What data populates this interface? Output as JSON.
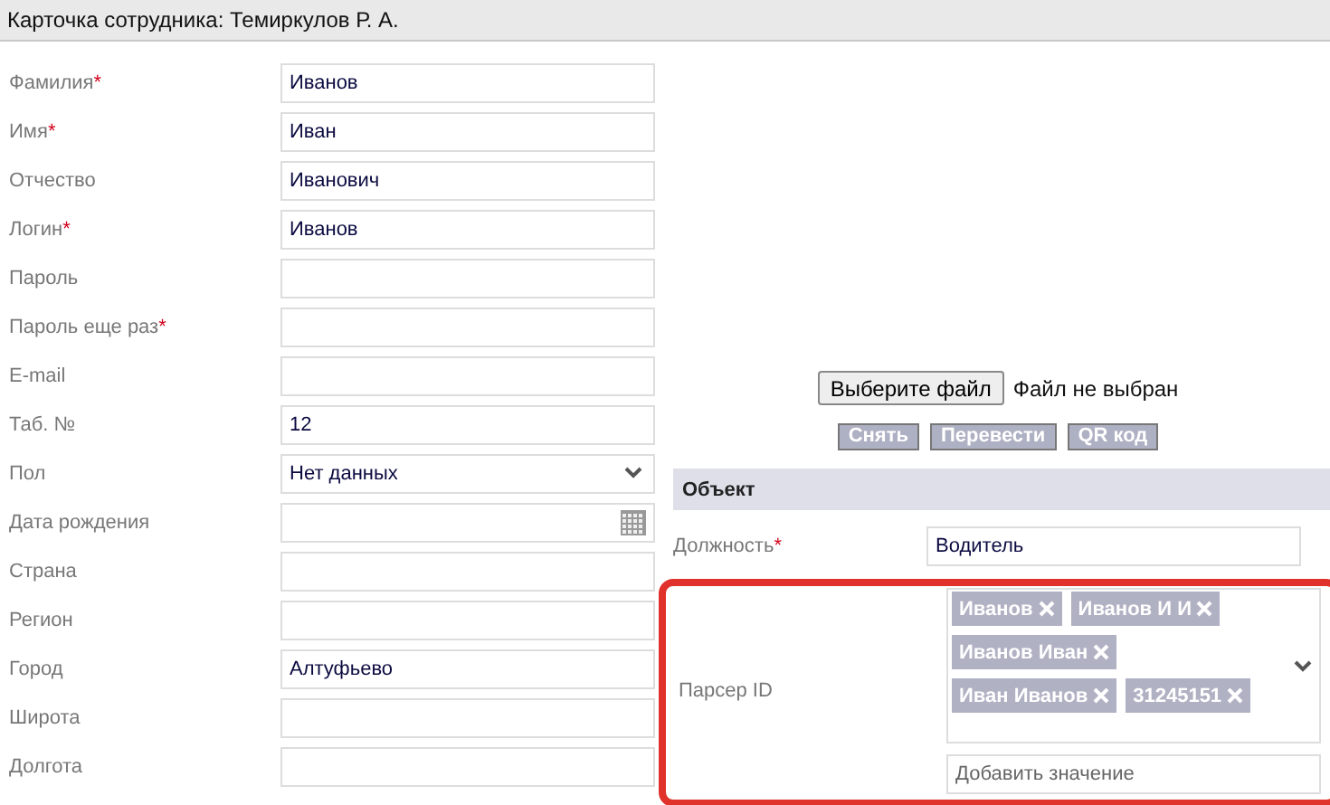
{
  "header": {
    "title": "Карточка сотрудника: Темиркулов Р. А."
  },
  "fields": [
    {
      "label": "Фамилия",
      "required_mark": "*",
      "kind": "text",
      "value": "Иванов"
    },
    {
      "label": "Имя",
      "required_mark": "*",
      "kind": "text",
      "value": "Иван"
    },
    {
      "label": "Отчество",
      "kind": "text",
      "value": "Иванович"
    },
    {
      "label": "Логин",
      "required_mark": "*",
      "kind": "text",
      "value": "Иванов"
    },
    {
      "label": "Пароль",
      "kind": "text"
    },
    {
      "label": "Пароль еще раз",
      "required_mark": "*",
      "kind": "text"
    },
    {
      "label": "E-mail",
      "kind": "text"
    },
    {
      "label": "Таб. №",
      "kind": "text",
      "value": "12"
    },
    {
      "label": "Пол",
      "kind": "select",
      "value": "Нет данных"
    },
    {
      "label": "Дата рождения",
      "kind": "date"
    },
    {
      "label": "Страна",
      "kind": "text"
    },
    {
      "label": "Регион",
      "kind": "text"
    },
    {
      "label": "Город",
      "kind": "text",
      "value": "Алтуфьево"
    },
    {
      "label": "Широта",
      "kind": "text"
    },
    {
      "label": "Долгота",
      "kind": "text"
    }
  ],
  "photo": {
    "file_button": "Выберите файл",
    "file_status": "Файл не выбран",
    "actions": [
      "Снять",
      "Перевести",
      "QR код"
    ]
  },
  "object_section": {
    "title": "Объект",
    "position": {
      "label": "Должность",
      "required_mark": "*",
      "value": "Водитель"
    },
    "parser_id": {
      "label": "Парсер ID",
      "highlighted": true,
      "tags": [
        "Иванов",
        "Иванов И И",
        "Иванов Иван",
        "Иван Иванов",
        "31245151"
      ],
      "placeholder": "Добавить значение"
    }
  }
}
